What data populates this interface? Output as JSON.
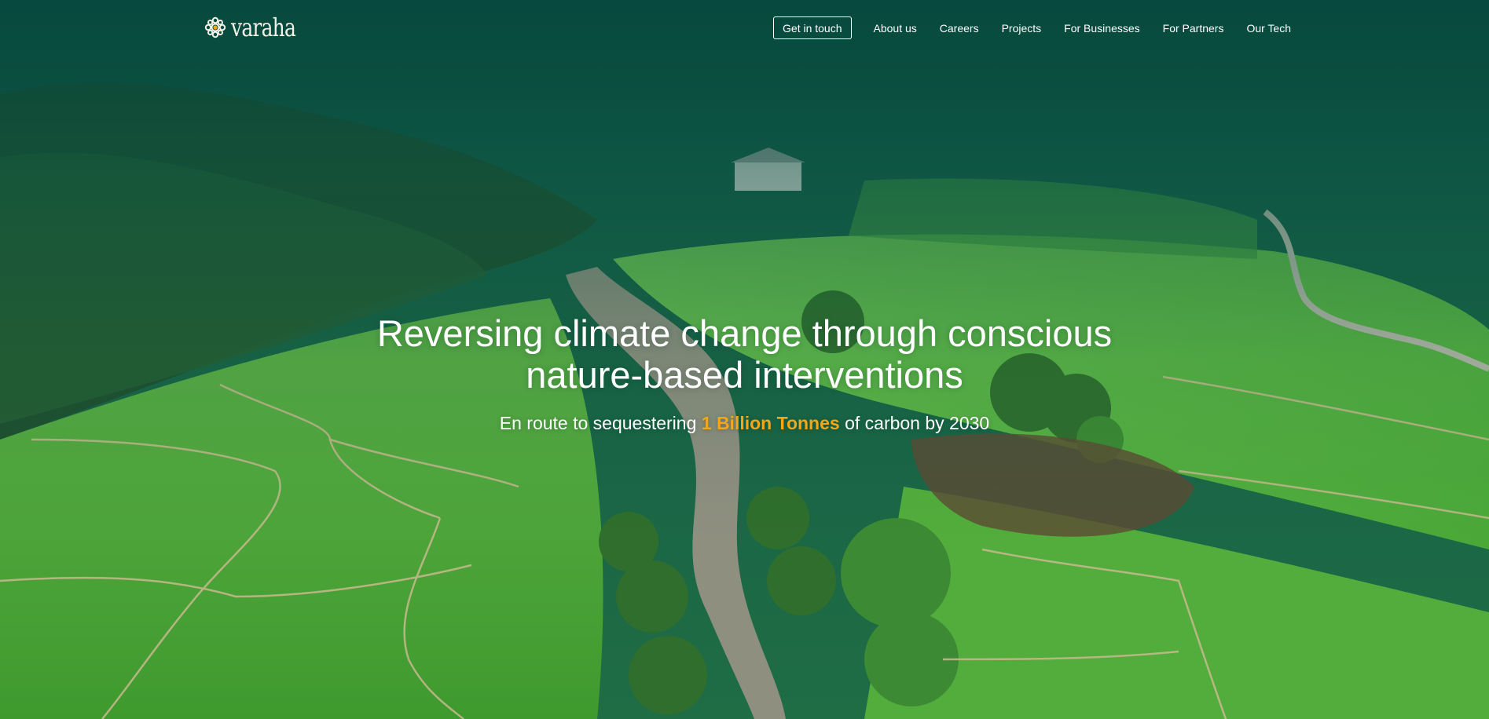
{
  "brand": {
    "logo_text": "varaha",
    "logo_icon": "flower-sun-icon"
  },
  "nav": {
    "cta_label": "Get in touch",
    "links": [
      "About us",
      "Careers",
      "Projects",
      "For Businesses",
      "For Partners",
      "Our Tech"
    ]
  },
  "hero": {
    "headline_line1": "Reversing climate change through conscious",
    "headline_line2": "nature-based interventions",
    "sub_prefix": "En route to sequestering ",
    "sub_highlight": "1 Billion Tonnes",
    "sub_suffix": " of carbon by 2030",
    "background": "aerial-rice-terraces-river-image"
  },
  "colors": {
    "accent": "#f2a71b",
    "overlay": "#0b5a4a",
    "text": "#ffffff"
  }
}
